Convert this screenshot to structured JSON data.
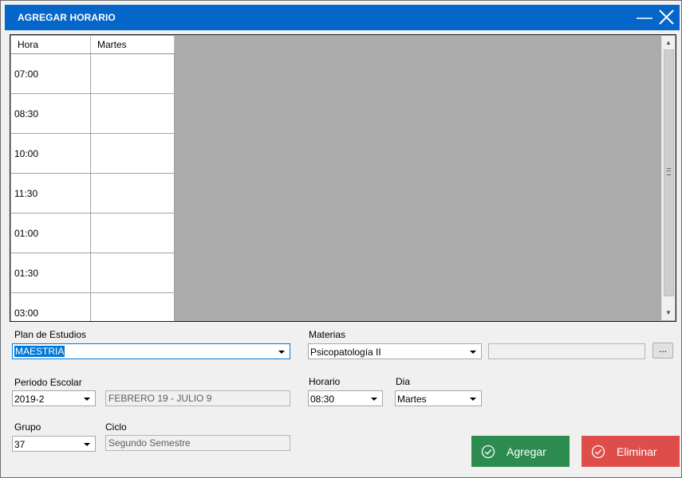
{
  "window": {
    "title": "AGREGAR HORARIO"
  },
  "schedule": {
    "columns": [
      "Hora",
      "Martes"
    ],
    "rows": [
      {
        "hora": "07:00",
        "martes": ""
      },
      {
        "hora": "08:30",
        "martes": ""
      },
      {
        "hora": "10:00",
        "martes": ""
      },
      {
        "hora": "11:30",
        "martes": ""
      },
      {
        "hora": "01:00",
        "martes": ""
      },
      {
        "hora": "01:30",
        "martes": ""
      },
      {
        "hora": "03:00",
        "martes": ""
      }
    ]
  },
  "form": {
    "plan": {
      "label": "Plan de Estudios",
      "value": "MAESTRIA"
    },
    "periodo": {
      "label": "Periodo Escolar",
      "value": "2019-2",
      "desc": "FEBRERO 19 - JULIO 9"
    },
    "grupo": {
      "label": "Grupo",
      "value": "37"
    },
    "ciclo": {
      "label": "Ciclo",
      "value": "Segundo Semestre"
    },
    "materias": {
      "label": "Materias",
      "value": "Psicopatología II",
      "extra": ""
    },
    "horario": {
      "label": "Horario",
      "value": "08:30"
    },
    "dia": {
      "label": "Dia",
      "value": "Martes"
    },
    "browse_label": "..."
  },
  "buttons": {
    "agregar": "Agregar",
    "eliminar": "Eliminar"
  },
  "colors": {
    "titlebar": "#0466c8",
    "agregar": "#2c8c4f",
    "eliminar": "#de4d4a",
    "selection": "#0078d7"
  }
}
